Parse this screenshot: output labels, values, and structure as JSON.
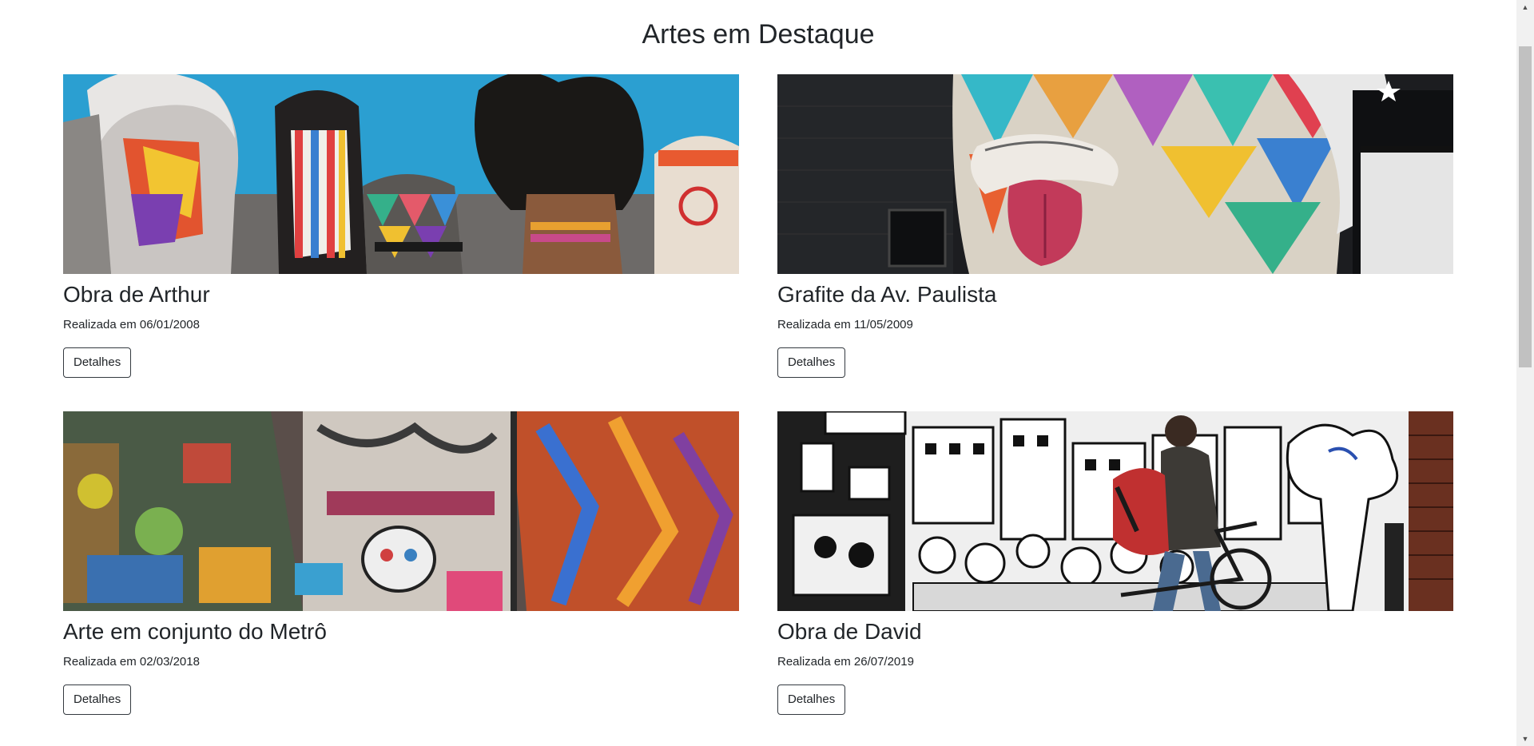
{
  "page": {
    "title": "Artes em Destaque"
  },
  "cards": [
    {
      "image": "mural-faces-colorful",
      "title": "Obra de Arthur",
      "date": "Realizada em 06/01/2008",
      "button": "Detalhes"
    },
    {
      "image": "mural-tongue-colorful",
      "title": "Grafite da Av. Paulista",
      "date": "Realizada em 11/05/2009",
      "button": "Detalhes"
    },
    {
      "image": "graffiti-alley",
      "title": "Arte em conjunto do Metrô",
      "date": "Realizada em 02/03/2018",
      "button": "Detalhes"
    },
    {
      "image": "black-white-mural-cyclist",
      "title": "Obra de David",
      "date": "Realizada em 26/07/2019",
      "button": "Detalhes"
    }
  ],
  "colors": {
    "text": "#212529",
    "button_border": "#343a40",
    "background": "#ffffff"
  },
  "scrollbar": {
    "up_icon": "▲",
    "down_icon": "▼"
  }
}
